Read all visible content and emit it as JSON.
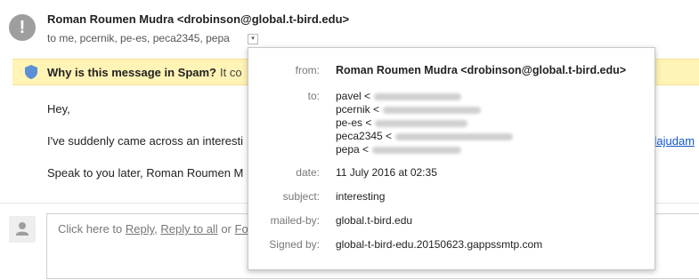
{
  "header": {
    "sender": "Roman Roumen Mudra <drobinson@global.t-bird.edu>",
    "recipients": "to me, pcernik, pe-es, peca2345, pepa",
    "toggle_icon": "▾"
  },
  "spam_banner": {
    "question": "Why is this message in Spam?",
    "rest": "It co"
  },
  "body": {
    "greeting": "Hey,",
    "line1": "I've suddenly came across an interesti",
    "link_fragment": "slajudam",
    "closing": "Speak to you later, Roman Roumen M"
  },
  "reply": {
    "prefix": "Click here to ",
    "reply_link": "Reply",
    "sep1": ", ",
    "reply_all_link": "Reply to all",
    "sep2": " or ",
    "forward_link": "Fo"
  },
  "details": {
    "from_label": "from:",
    "from_value": "Roman Roumen Mudra <drobinson@global.t-bird.edu>",
    "to_label": "to:",
    "to_list": [
      "pavel <",
      "pcernik <",
      "pe-es <",
      "peca2345 <",
      "pepa <"
    ],
    "date_label": "date:",
    "date_value": "11 July 2016 at 02:35",
    "subject_label": "subject:",
    "subject_value": "interesting",
    "mailed_by_label": "mailed-by:",
    "mailed_by_value": "global.t-bird.edu",
    "signed_by_label": "Signed by:",
    "signed_by_value": "global-t-bird-edu.20150623.gappssmtp.com"
  },
  "colors": {
    "banner_bg": "#fff3b5",
    "shield": "#5b8fd6",
    "link": "#1155cc"
  }
}
